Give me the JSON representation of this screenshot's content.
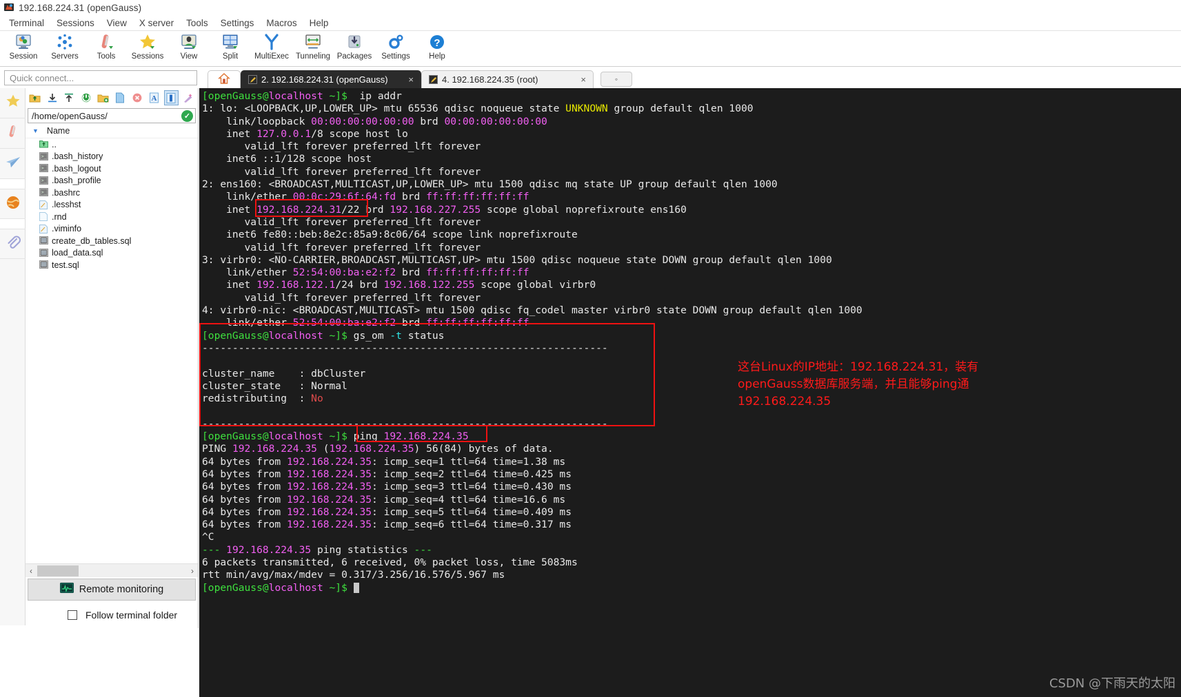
{
  "window": {
    "title": "192.168.224.31 (openGauss)",
    "app_icon": "mobaxterm-icon"
  },
  "menubar": [
    "Terminal",
    "Sessions",
    "View",
    "X server",
    "Tools",
    "Settings",
    "Macros",
    "Help"
  ],
  "toolbar": [
    {
      "label": "Session",
      "icon": "session-icon"
    },
    {
      "label": "Servers",
      "icon": "servers-icon"
    },
    {
      "label": "Tools",
      "icon": "tools-icon"
    },
    {
      "label": "Sessions",
      "icon": "sessions-star-icon"
    },
    {
      "label": "View",
      "icon": "view-icon"
    },
    {
      "label": "Split",
      "icon": "split-icon"
    },
    {
      "label": "MultiExec",
      "icon": "multiexec-icon"
    },
    {
      "label": "Tunneling",
      "icon": "tunneling-icon"
    },
    {
      "label": "Packages",
      "icon": "packages-icon"
    },
    {
      "label": "Settings",
      "icon": "settings-gear-icon"
    },
    {
      "label": "Help",
      "icon": "help-question-icon"
    }
  ],
  "quick_connect": {
    "placeholder": "Quick connect..."
  },
  "rail": [
    {
      "icon": "star-icon"
    },
    {
      "icon": "swiss-knife-icon"
    },
    {
      "icon": "paper-plane-icon"
    },
    {
      "icon": "globe-icon"
    },
    {
      "icon": "paperclip-icon"
    }
  ],
  "browser": {
    "toolbar_icons": [
      "up-folder-icon",
      "download-icon",
      "upload-icon",
      "refresh-icon",
      "new-folder-icon",
      "new-file-icon",
      "delete-icon",
      "text-mode-icon",
      "binary-mode-icon",
      "edit-wand-icon"
    ],
    "path": "/home/openGauss/",
    "path_status": "✓",
    "column_header": "Name",
    "sort_caret": "▼",
    "files": [
      {
        "name": "..",
        "icon": "parent-folder-icon"
      },
      {
        "name": ".bash_history",
        "icon": "script-file-icon"
      },
      {
        "name": ".bash_logout",
        "icon": "script-file-icon"
      },
      {
        "name": ".bash_profile",
        "icon": "script-file-icon"
      },
      {
        "name": ".bashrc",
        "icon": "script-file-icon"
      },
      {
        "name": ".lesshst",
        "icon": "text-file-icon"
      },
      {
        "name": ".rnd",
        "icon": "blank-file-icon"
      },
      {
        "name": ".viminfo",
        "icon": "text-file-icon"
      },
      {
        "name": "create_db_tables.sql",
        "icon": "sql-file-icon"
      },
      {
        "name": "load_data.sql",
        "icon": "sql-file-icon"
      },
      {
        "name": "test.sql",
        "icon": "sql-file-icon"
      }
    ],
    "scroll_left": "‹",
    "scroll_right": "›",
    "remote_monitoring": "Remote monitoring",
    "follow_terminal_folder": "Follow terminal folder"
  },
  "tabs": {
    "home_icon": "home-icon",
    "items": [
      {
        "label": "2. 192.168.224.31 (openGauss)",
        "active": true,
        "close": "×"
      },
      {
        "label": "4. 192.168.224.35 (root)",
        "active": false,
        "close": "×"
      }
    ],
    "new_tab": "◦"
  },
  "terminal": {
    "prompt_user": "[openGauss@",
    "prompt_host": "localhost",
    "prompt_tail": " ~]$ ",
    "lines": [
      {
        "t": "prompt",
        "cmd": " ip addr"
      },
      {
        "t": "raw",
        "s": "1: lo: <LOOPBACK,UP,LOWER_UP> mtu 65536 qdisc noqueue state ",
        "y": "UNKNOWN",
        "s2": " group default qlen 1000"
      },
      {
        "t": "mac",
        "pre": "    link/loopback ",
        "m1": "00:00:00:00:00:00",
        "mid": " brd ",
        "m2": "00:00:00:00:00:00"
      },
      {
        "t": "inet",
        "pre": "    inet ",
        "ip": "127.0.0.1",
        "post": "/8 scope host lo"
      },
      {
        "t": "plain",
        "s": "       valid_lft forever preferred_lft forever"
      },
      {
        "t": "plain",
        "s": "    inet6 ::1/128 scope host"
      },
      {
        "t": "plain",
        "s": "       valid_lft forever preferred_lft forever"
      },
      {
        "t": "plain",
        "s": "2: ens160: <BROADCAST,MULTICAST,UP,LOWER_UP> mtu 1500 qdisc mq state UP group default qlen 1000"
      },
      {
        "t": "mac",
        "pre": "    link/ether ",
        "m1": "00:0c:29:6f:64:fd",
        "mid": " brd ",
        "m2": "ff:ff:ff:ff:ff:ff"
      },
      {
        "t": "inet2",
        "pre": "    inet ",
        "ip": "192.168.224.31",
        "mid": "/22 brd ",
        "ip2": "192.168.227.255",
        "post": " scope global noprefixroute ens160"
      },
      {
        "t": "plain",
        "s": "       valid_lft forever preferred_lft forever"
      },
      {
        "t": "plain",
        "s": "    inet6 fe80::beb:8e2c:85a9:8c06/64 scope link noprefixroute"
      },
      {
        "t": "plain",
        "s": "       valid_lft forever preferred_lft forever"
      },
      {
        "t": "plain",
        "s": "3: virbr0: <NO-CARRIER,BROADCAST,MULTICAST,UP> mtu 1500 qdisc noqueue state DOWN group default qlen 1000"
      },
      {
        "t": "mac",
        "pre": "    link/ether ",
        "m1": "52:54:00:ba:e2:f2",
        "mid": " brd ",
        "m2": "ff:ff:ff:ff:ff:ff"
      },
      {
        "t": "inet2",
        "pre": "    inet ",
        "ip": "192.168.122.1",
        "mid": "/24 brd ",
        "ip2": "192.168.122.255",
        "post": " scope global virbr0"
      },
      {
        "t": "plain",
        "s": "       valid_lft forever preferred_lft forever"
      },
      {
        "t": "plain",
        "s": "4: virbr0-nic: <BROADCAST,MULTICAST> mtu 1500 qdisc fq_codel master virbr0 state DOWN group default qlen 1000"
      },
      {
        "t": "mac",
        "pre": "    link/ether ",
        "m1": "52:54:00:ba:e2:f2",
        "mid": " brd ",
        "m2": "ff:ff:ff:ff:ff:ff"
      },
      {
        "t": "promptcmd",
        "cmd": "gs_om ",
        "flag": "-t",
        "rest": " status"
      },
      {
        "t": "plain",
        "s": "-------------------------------------------------------------------"
      },
      {
        "t": "plain",
        "s": ""
      },
      {
        "t": "plain",
        "s": "cluster_name    : dbCluster"
      },
      {
        "t": "plain",
        "s": "cluster_state   : Normal"
      },
      {
        "t": "kvred",
        "k": "redistributing  : ",
        "v": "No"
      },
      {
        "t": "plain",
        "s": ""
      },
      {
        "t": "plain",
        "s": "-------------------------------------------------------------------"
      },
      {
        "t": "pingcmd",
        "cmd": "ping ",
        "ip": "192.168.224.35"
      },
      {
        "t": "pingline",
        "pre": "PING ",
        "ip": "192.168.224.35",
        "mid": " (",
        "ip2": "192.168.224.35",
        "post": ") 56(84) bytes of data."
      },
      {
        "t": "reply",
        "pre": "64 bytes from ",
        "ip": "192.168.224.35",
        "post": ": icmp_seq=1 ttl=64 time=1.38 ms"
      },
      {
        "t": "reply",
        "pre": "64 bytes from ",
        "ip": "192.168.224.35",
        "post": ": icmp_seq=2 ttl=64 time=0.425 ms"
      },
      {
        "t": "reply",
        "pre": "64 bytes from ",
        "ip": "192.168.224.35",
        "post": ": icmp_seq=3 ttl=64 time=0.430 ms"
      },
      {
        "t": "reply",
        "pre": "64 bytes from ",
        "ip": "192.168.224.35",
        "post": ": icmp_seq=4 ttl=64 time=16.6 ms"
      },
      {
        "t": "reply",
        "pre": "64 bytes from ",
        "ip": "192.168.224.35",
        "post": ": icmp_seq=5 ttl=64 time=0.409 ms"
      },
      {
        "t": "reply",
        "pre": "64 bytes from ",
        "ip": "192.168.224.35",
        "post": ": icmp_seq=6 ttl=64 time=0.317 ms"
      },
      {
        "t": "plain",
        "s": "^C"
      },
      {
        "t": "stats",
        "pre": "--- ",
        "ip": "192.168.224.35",
        "mid": " ping statistics ",
        "post": "---"
      },
      {
        "t": "plain",
        "s": "6 packets transmitted, 6 received, 0% packet loss, time 5083ms"
      },
      {
        "t": "plain",
        "s": "rtt min/avg/max/mdev = 0.317/3.256/16.576/5.967 ms"
      },
      {
        "t": "promptcursor"
      }
    ]
  },
  "annotation": {
    "color": "#ff1a1a",
    "line1": "这台Linux的IP地址：192.168.224.31，装有",
    "line2": "openGauss数据库服务端，并且能够ping通",
    "line3": "192.168.224.35"
  },
  "watermark": "CSDN @下雨天的太阳"
}
